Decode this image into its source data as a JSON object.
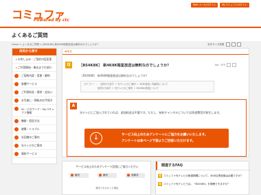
{
  "header": {
    "logo": "コミュファ",
    "logo_sub": "Powered by ctc",
    "btn_web": "Web メールログイン",
    "btn_mypage": "Myコミュファログイン"
  },
  "page_title": "よくあるご質問",
  "breadcrumb": "Home > よくあるご質問 > [BS4K8K] 新4K8K衛星放送は無料なのでしょうか？",
  "font_size_label": "文字サイズ変更",
  "sidebar": {
    "title": "目的から探す",
    "items": [
      {
        "label": "お申し込み・ご契約内容変更",
        "type": "sub"
      },
      {
        "label": "ご利用開始・撤去までの流れ",
        "type": "sub"
      },
      {
        "label": "ご契約内容・変更・解約",
        "type": "icon"
      },
      {
        "label": "各種サービス",
        "type": "icon"
      },
      {
        "label": "ご利用料金・請求・支払い",
        "type": "icon"
      },
      {
        "label": "お引越し・移転のお手続き",
        "type": "icon"
      },
      {
        "label": "ID・パスワード・Myコミュファ情報",
        "type": "icon-tall"
      },
      {
        "label": "機能・設定方法",
        "type": "icon"
      },
      {
        "label": "故障・トラブル",
        "type": "icon"
      },
      {
        "label": "光回線のご案内",
        "type": "icon"
      },
      {
        "label": "光テレビのご案内",
        "type": "icon"
      },
      {
        "label": "資料サービス",
        "type": "icon"
      }
    ]
  },
  "main": {
    "back": "◀ 戻る",
    "q_badge": "Q",
    "q_title": "［BS4K8K］ 新4K8K衛星放送は無料なのでしょうか？",
    "page_count": "No：575",
    "q_body": "［BS4K8K］ 新4K8K衛星放送は無料なのでしょうか？",
    "categories": [
      "カテゴリー ：　目的から探す ＞ 光テレビのご案内 ＞ 4K8K放送 / 衛星料について",
      "　　　　　　目的から探す ＞ 光テレビのご案内 ＞ BS4K8K放送について"
    ],
    "a_badge": "A",
    "a_text": "光テレビにご加入されていれば、追加料金は不要です。ただし、有料チャンネルについては別途費用が発生します。",
    "survey_btn_l1": "サービス向上のためアンケートにご協力をお願いいたします。",
    "survey_btn_l2": "アンケートは本ページ下部よりご回答いただけます。"
  },
  "survey": {
    "question": "サービス向上のためアンケート回答にご協力ください",
    "options": [
      "解決",
      "解決",
      "未解決"
    ],
    "reason": "解決されなかった理由"
  },
  "related": {
    "title": "関連するFAQ",
    "items": [
      "コミュファ光テレビの無償期間について、4K対応受信機は必要ですか？",
      "コミュファ光テレビでは、「BS4K8K」を視聴できますか？"
    ]
  },
  "colors": {
    "accent": "#ea5504",
    "q_badge": "#f0a500"
  }
}
